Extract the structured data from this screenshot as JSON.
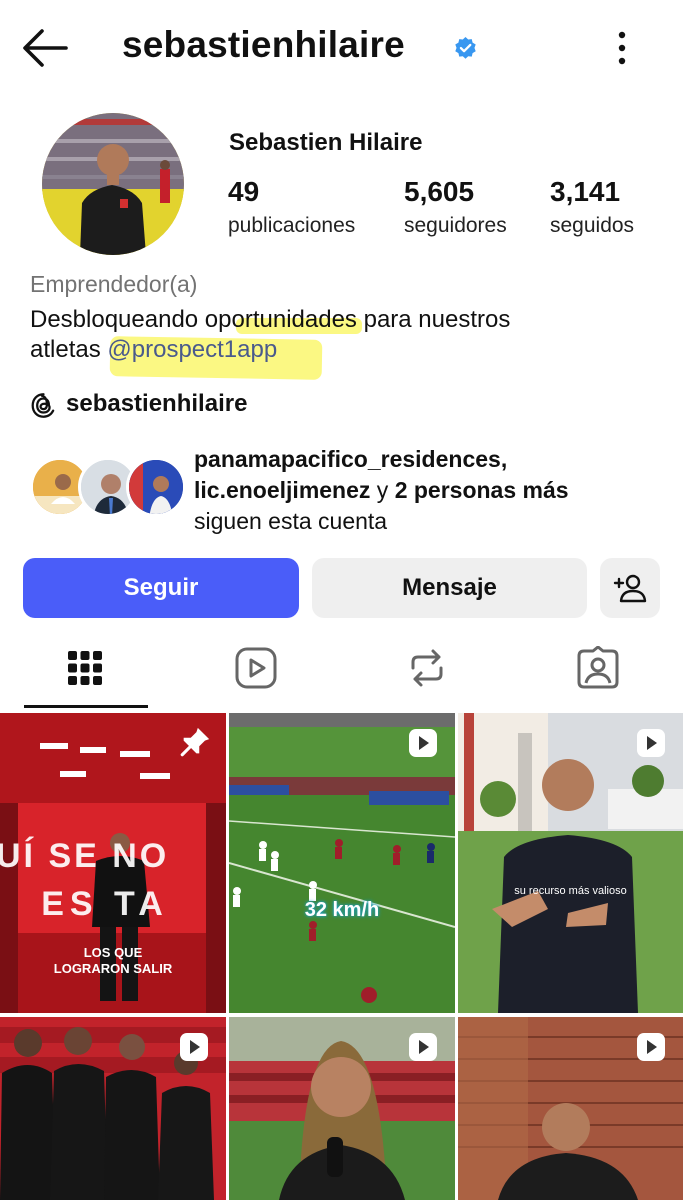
{
  "header": {
    "username": "sebastienhilaire",
    "verified": true,
    "back_icon": "arrow-left-icon",
    "more_icon": "more-vertical-icon"
  },
  "profile": {
    "display_name": "Sebastien Hilaire",
    "stats": [
      {
        "number": "49",
        "label": "publicaciones"
      },
      {
        "number": "5,605",
        "label": "seguidores"
      },
      {
        "number": "3,141",
        "label": "seguidos"
      }
    ],
    "category": "Emprendedor(a)",
    "bio_line1": "Desbloqueando oportunidades para nuestros",
    "bio_line2_prefix": "atletas ",
    "bio_mention": "@prospect1app",
    "threads_handle": "sebastienhilaire"
  },
  "followed_by": {
    "line1": "panamapacifico_residences,",
    "line2_bold": "lic.enoeljimenez",
    "line2_rest": " y ",
    "line2_bold2": "2 personas más",
    "line3": "siguen esta cuenta"
  },
  "actions": {
    "follow": "Seguir",
    "message": "Mensaje",
    "add_icon": "add-person-icon"
  },
  "tabs": [
    {
      "name": "grid",
      "icon": "grid-icon",
      "active": true
    },
    {
      "name": "reels",
      "icon": "reels-icon",
      "active": false
    },
    {
      "name": "reposts",
      "icon": "repost-icon",
      "active": false
    },
    {
      "name": "tagged",
      "icon": "tagged-icon",
      "active": false
    }
  ],
  "posts": [
    {
      "caption_line1": "LOS QUE",
      "caption_line2": "LOGRARON SALIR",
      "wall_text1": "UÍ SE NO",
      "wall_text2": "ES TA",
      "pinned": true
    },
    {
      "caption": "32 km/h",
      "reel": true
    },
    {
      "caption": "su recurso más valioso",
      "reel": true
    },
    {
      "reel": true
    },
    {
      "reel": true
    },
    {
      "reel": true
    }
  ],
  "colors": {
    "accent": "#4a5df9",
    "highlight": "#faf55a",
    "mention": "#4a5a8c"
  }
}
